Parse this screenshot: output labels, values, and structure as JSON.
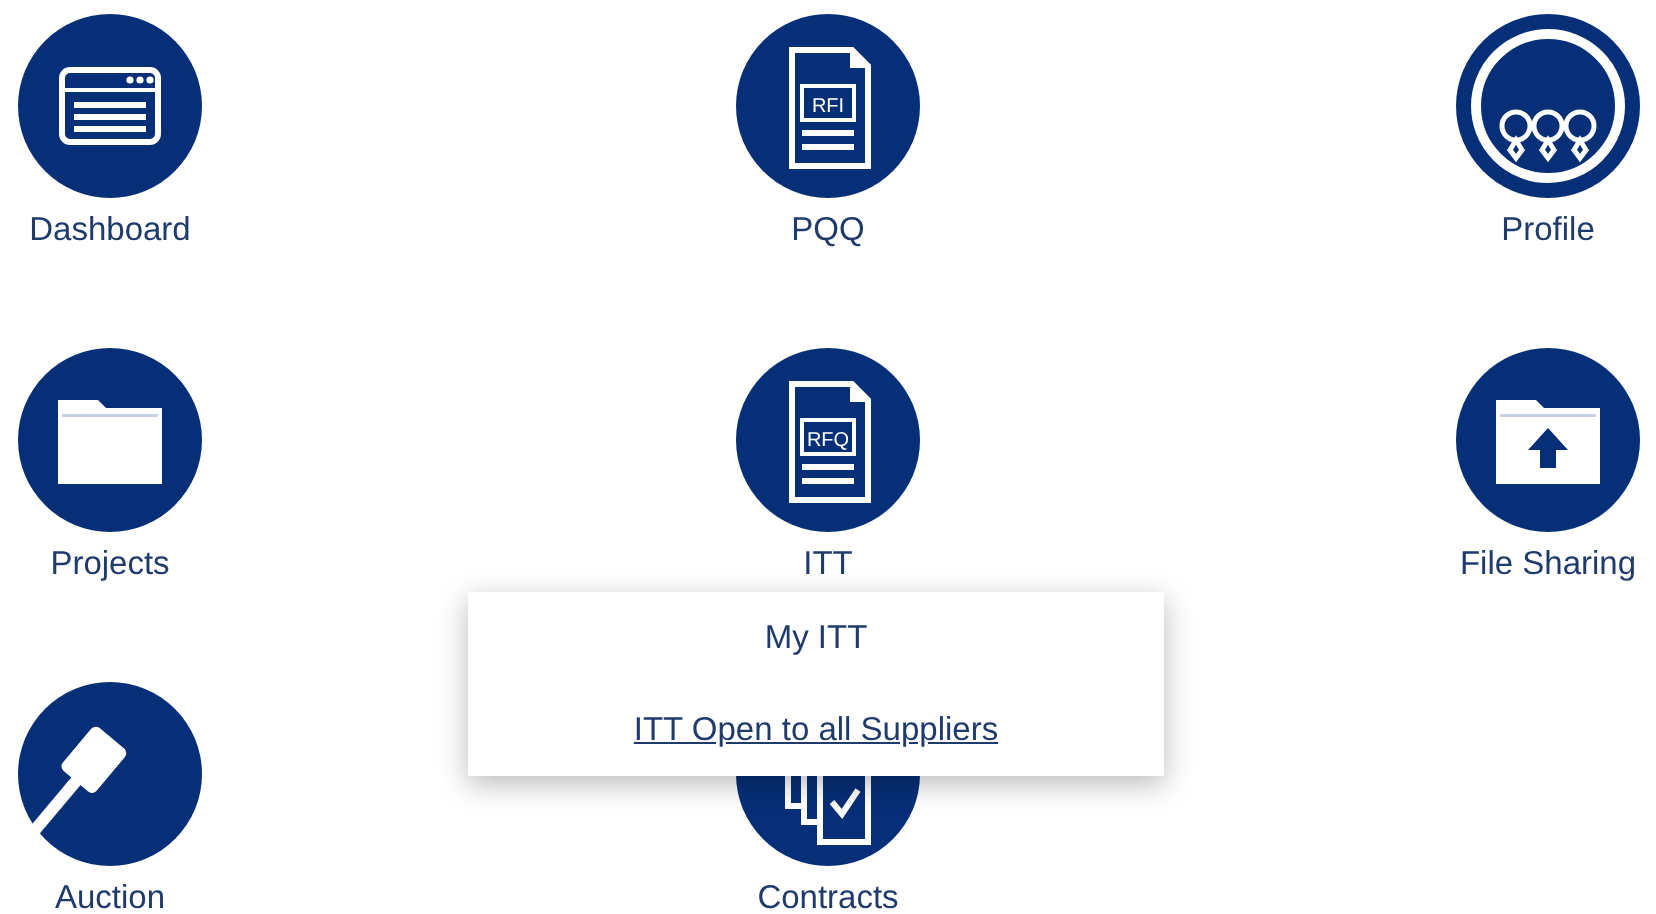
{
  "tiles": [
    {
      "label": "Dashboard",
      "kind": "window"
    },
    {
      "label": "PQQ",
      "kind": "document",
      "tag": "RFI"
    },
    {
      "label": "Profile",
      "kind": "people"
    },
    {
      "label": "Projects",
      "kind": "folder"
    },
    {
      "label": "ITT",
      "kind": "document",
      "tag": "RFQ"
    },
    {
      "label": "File Sharing",
      "kind": "upload"
    },
    {
      "label": "Auction",
      "kind": "gavel"
    },
    {
      "label": "Contracts",
      "kind": "pages"
    }
  ],
  "menu": {
    "items": [
      {
        "label": "My ITT",
        "hovered": false
      },
      {
        "label": "ITT Open to all Suppliers",
        "hovered": true
      }
    ]
  }
}
